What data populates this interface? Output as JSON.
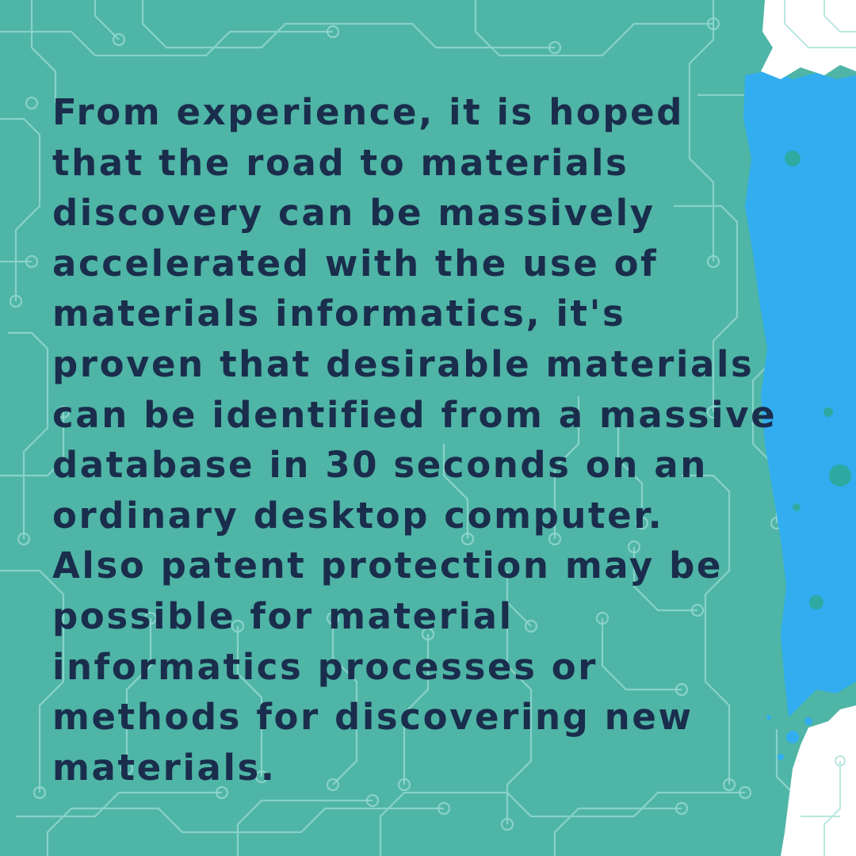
{
  "colors": {
    "background": "#4fb5a6",
    "circuit": "#93d8cf",
    "blue_panel": "#31adf0",
    "text": "#1a2d4c",
    "white": "#ffffff"
  },
  "quote": {
    "lines": [
      "From experience, it is hoped",
      "that the road to materials",
      "discovery can be massively",
      "accelerated with the use of",
      "materials informatics, it's",
      "proven that desirable materials",
      "can be identified from a massive",
      "database in 30 seconds on an",
      "ordinary desktop computer.",
      "Also patent protection may be",
      "possible for material",
      "informatics processes or",
      "methods for discovering new",
      "materials."
    ]
  }
}
